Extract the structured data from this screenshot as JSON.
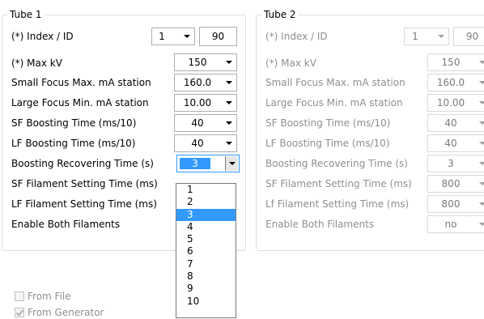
{
  "tube1": {
    "title": "Tube 1",
    "index_label": "(*) Index / ID",
    "index_value": "1",
    "id_value": "90",
    "rows": [
      {
        "label": "(*) Max kV",
        "value": "150"
      },
      {
        "label": "Small Focus Max. mA station",
        "value": "160.0"
      },
      {
        "label": "Large Focus Min. mA station",
        "value": "10.00"
      },
      {
        "label": "SF Boosting Time (ms/10)",
        "value": "40"
      },
      {
        "label": "LF Boosting Time (ms/10)",
        "value": "40"
      },
      {
        "label": "Boosting Recovering Time (s)",
        "value": "3"
      },
      {
        "label": "SF Filament Setting Time (ms)",
        "value": ""
      },
      {
        "label": "LF Filament Setting Time (ms)",
        "value": ""
      },
      {
        "label": "Enable Both Filaments",
        "value": ""
      }
    ]
  },
  "tube2": {
    "title": "Tube 2",
    "index_label": "(*) Index / ID",
    "index_value": "1",
    "id_value": "90",
    "rows": [
      {
        "label": "(*) Max kV",
        "value": "150"
      },
      {
        "label": "Small Focus Max. mA station",
        "value": "160.0"
      },
      {
        "label": "Large Focus Min. mA station",
        "value": "10.00"
      },
      {
        "label": "SF Boosting Time (ms/10)",
        "value": "40"
      },
      {
        "label": "LF Boosting Time (ms/10)",
        "value": "40"
      },
      {
        "label": "Boosting Recovering Time (s)",
        "value": "3"
      },
      {
        "label": "SF Filament Setting Time (ms)",
        "value": "800"
      },
      {
        "label": "Lf Filament Setting Time (ms)",
        "value": "800"
      },
      {
        "label": "Enable Both Filaments",
        "value": "no"
      }
    ]
  },
  "dropdown": {
    "options": [
      "1",
      "2",
      "3",
      "4",
      "5",
      "6",
      "7",
      "8",
      "9",
      "10"
    ],
    "selected": "3"
  },
  "source": {
    "from_file_label": "From File",
    "from_file_checked": false,
    "from_generator_label": "From Generator",
    "from_generator_checked": true
  },
  "colors": {
    "selection": "#3399ff",
    "disabled_text": "#8f8f8f",
    "group_border": "#d5dfe5"
  }
}
